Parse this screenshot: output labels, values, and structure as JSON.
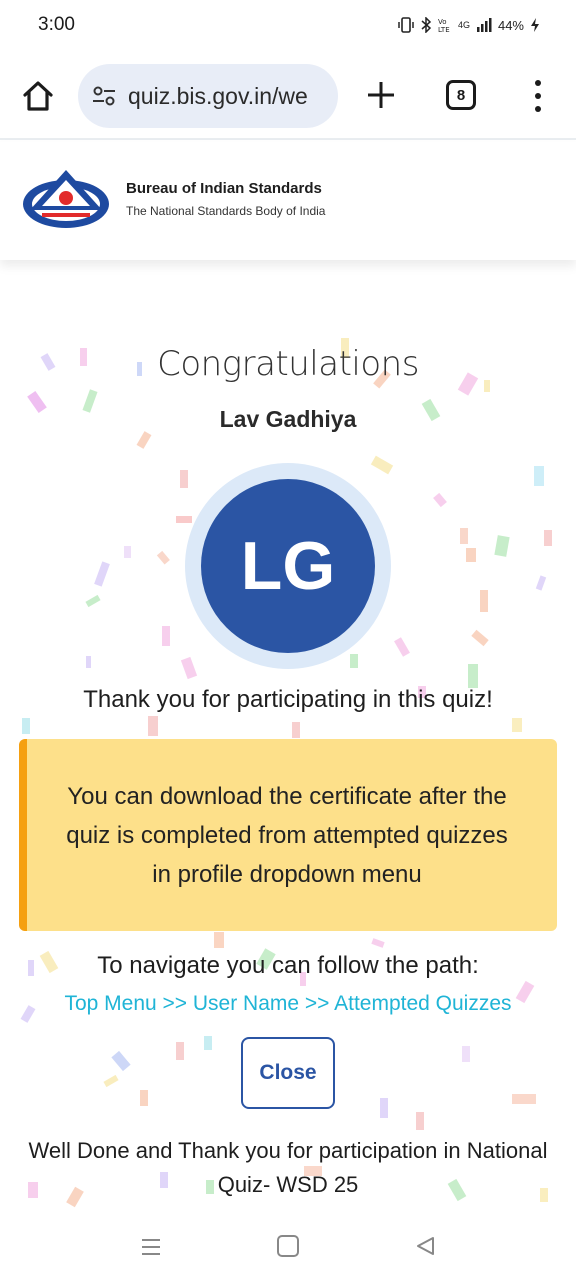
{
  "status_bar": {
    "time": "3:00",
    "network": "4G",
    "battery": "44%"
  },
  "browser": {
    "url": "quiz.bis.gov.in/we",
    "tab_count": "8"
  },
  "header": {
    "org_name": "Bureau of Indian Standards",
    "org_subtitle": "The National Standards Body of India"
  },
  "main": {
    "heading": "Congratulations",
    "user_name": "Lav Gadhiya",
    "avatar_initials": "LG",
    "thanks_message": "Thank you for participating in this quiz!",
    "certificate_note": "You can download the certificate after the quiz is completed from attempted quizzes in profile dropdown menu",
    "navigate_hint": "To navigate you can follow the path:",
    "navigate_path": "Top Menu >> User Name >> Attempted Quizzes",
    "close_label": "Close",
    "footer_message": "Well Done and Thank you for participation in National Quiz- WSD 25"
  },
  "colors": {
    "brand_blue": "#2b55a4",
    "note_background": "#fde08a",
    "note_border": "#f5a011",
    "path_link": "#1fb4d6"
  }
}
